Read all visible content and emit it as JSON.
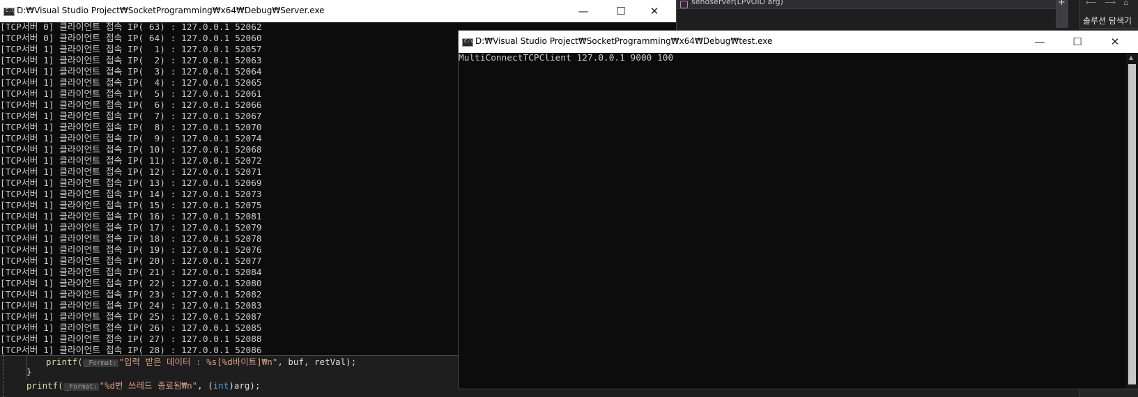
{
  "ide": {
    "toolbar_item": "sendserver(LPVOID arg)",
    "nav_arrows": "⟵ ⟶ ⌂",
    "panel_title": "솔루션 탐색기",
    "code": {
      "line1_fn": "printf(",
      "line1_hint": "_Format:",
      "line1_str": "\"입력 받은 데이터 : %s[%d바이트]₩n\"",
      "line1_rest": ", buf, retVal);",
      "line2": "}",
      "line3_fn": "printf(",
      "line3_hint": "_Format:",
      "line3_str": "\"%d번 쓰레드 종료됨₩n\"",
      "line3_rest_a": ", (",
      "line3_kw": "int",
      "line3_rest_b": ")arg);"
    }
  },
  "server_window": {
    "icon_label": "C:\\",
    "title": "D:₩Visual Studio Project₩SocketProgramming₩x64₩Debug₩Server.exe",
    "controls": {
      "minimize": "—",
      "maximize": "☐",
      "close": "✕"
    },
    "lines": [
      "[TCP서버 0] 클라이언트 접속 IP( 63) : 127.0.0.1 52062",
      "[TCP서버 0] 클라이언트 접속 IP( 64) : 127.0.0.1 52060",
      "[TCP서버 1] 클라이언트 접속 IP(  1) : 127.0.0.1 52057",
      "[TCP서버 1] 클라이언트 접속 IP(  2) : 127.0.0.1 52063",
      "[TCP서버 1] 클라이언트 접속 IP(  3) : 127.0.0.1 52064",
      "[TCP서버 1] 클라이언트 접속 IP(  4) : 127.0.0.1 52065",
      "[TCP서버 1] 클라이언트 접속 IP(  5) : 127.0.0.1 52061",
      "[TCP서버 1] 클라이언트 접속 IP(  6) : 127.0.0.1 52066",
      "[TCP서버 1] 클라이언트 접속 IP(  7) : 127.0.0.1 52067",
      "[TCP서버 1] 클라이언트 접속 IP(  8) : 127.0.0.1 52070",
      "[TCP서버 1] 클라이언트 접속 IP(  9) : 127.0.0.1 52074",
      "[TCP서버 1] 클라이언트 접속 IP( 10) : 127.0.0.1 52068",
      "[TCP서버 1] 클라이언트 접속 IP( 11) : 127.0.0.1 52072",
      "[TCP서버 1] 클라이언트 접속 IP( 12) : 127.0.0.1 52071",
      "[TCP서버 1] 클라이언트 접속 IP( 13) : 127.0.0.1 52069",
      "[TCP서버 1] 클라이언트 접속 IP( 14) : 127.0.0.1 52073",
      "[TCP서버 1] 클라이언트 접속 IP( 15) : 127.0.0.1 52075",
      "[TCP서버 1] 클라이언트 접속 IP( 16) : 127.0.0.1 52081",
      "[TCP서버 1] 클라이언트 접속 IP( 17) : 127.0.0.1 52079",
      "[TCP서버 1] 클라이언트 접속 IP( 18) : 127.0.0.1 52078",
      "[TCP서버 1] 클라이언트 접속 IP( 19) : 127.0.0.1 52076",
      "[TCP서버 1] 클라이언트 접속 IP( 20) : 127.0.0.1 52077",
      "[TCP서버 1] 클라이언트 접속 IP( 21) : 127.0.0.1 52084",
      "[TCP서버 1] 클라이언트 접속 IP( 22) : 127.0.0.1 52080",
      "[TCP서버 1] 클라이언트 접속 IP( 23) : 127.0.0.1 52082",
      "[TCP서버 1] 클라이언트 접속 IP( 24) : 127.0.0.1 52083",
      "[TCP서버 1] 클라이언트 접속 IP( 25) : 127.0.0.1 52087",
      "[TCP서버 1] 클라이언트 접속 IP( 26) : 127.0.0.1 52085",
      "[TCP서버 1] 클라이언트 접속 IP( 27) : 127.0.0.1 52088",
      "[TCP서버 1] 클라이언트 접속 IP( 28) : 127.0.0.1 52086"
    ]
  },
  "test_window": {
    "icon_label": "C:\\",
    "title": "D:₩Visual Studio Project₩SocketProgramming₩x64₩Debug₩test.exe",
    "controls": {
      "minimize": "—",
      "maximize": "☐",
      "close": "✕"
    },
    "lines": [
      "MultiConnectTCPClient 127.0.0.1 9000 100"
    ],
    "scroll_up": "▲"
  }
}
